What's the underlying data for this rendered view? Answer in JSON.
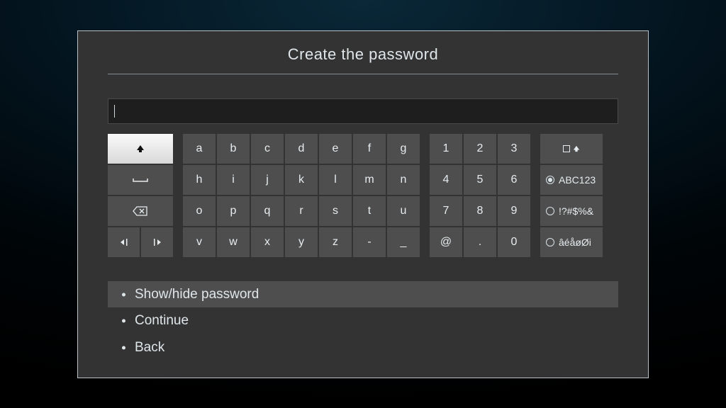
{
  "title": "Create the password",
  "input": {
    "value": ""
  },
  "keyboard": {
    "controls": {
      "shift": "shift",
      "space": "space",
      "backspace": "backspace",
      "cursor_left": "cursor-left",
      "cursor_right": "cursor-right"
    },
    "alpha": [
      [
        "a",
        "b",
        "c",
        "d",
        "e",
        "f",
        "g"
      ],
      [
        "h",
        "i",
        "j",
        "k",
        "l",
        "m",
        "n"
      ],
      [
        "o",
        "p",
        "q",
        "r",
        "s",
        "t",
        "u"
      ],
      [
        "v",
        "w",
        "x",
        "y",
        "z",
        "-",
        "_"
      ]
    ],
    "num": [
      [
        "1",
        "2",
        "3"
      ],
      [
        "4",
        "5",
        "6"
      ],
      [
        "7",
        "8",
        "9"
      ],
      [
        "@",
        ".",
        "0"
      ]
    ],
    "modes": {
      "caps_icon": "caps",
      "abc": "ABC123",
      "sym": "!?#$%&",
      "acc": "âéåøØi"
    },
    "selected_mode": "abc"
  },
  "options": {
    "show_hide": "Show/hide password",
    "continue": "Continue",
    "back": "Back"
  }
}
